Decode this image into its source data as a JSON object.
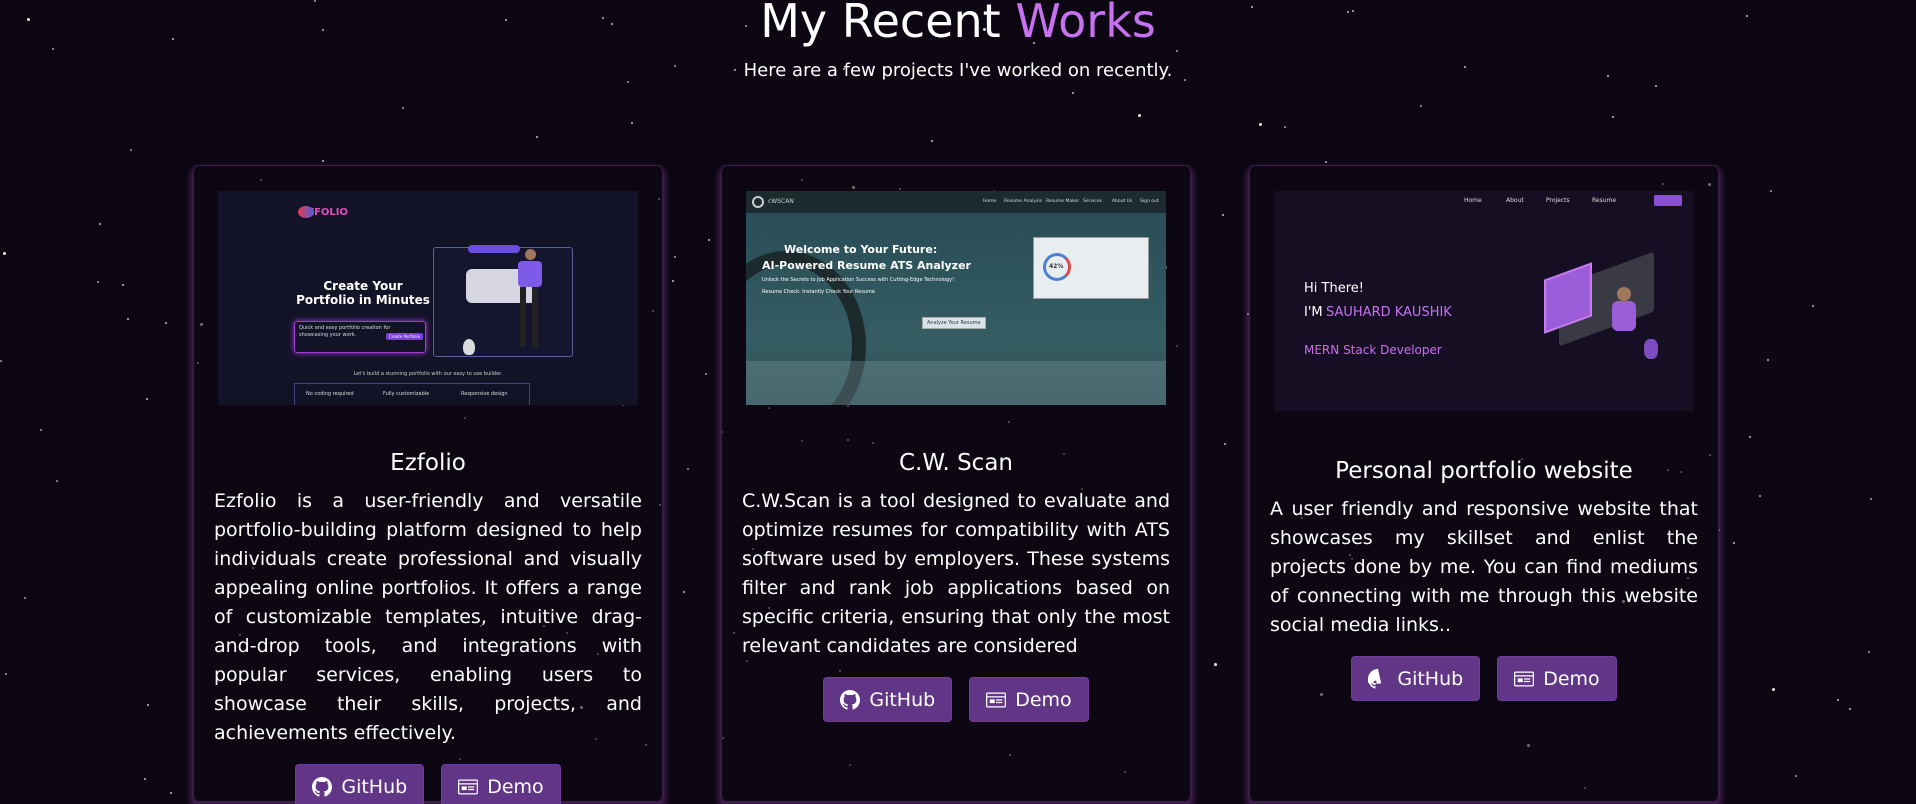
{
  "heading": {
    "prefix": "My Recent",
    "accent": "Works"
  },
  "subheading": "Here are a few projects I've worked on recently.",
  "colors": {
    "accent": "#c770f0",
    "button": "#623686",
    "background": "#0c0713"
  },
  "projects": [
    {
      "title": "Ezfolio",
      "description": "Ezfolio is a user-friendly and versatile portfolio-building platform designed to help individuals create professional and visually appealing online portfolios. It offers a range of customizable templates, intuitive drag-and-drop tools, and integrations with popular services, enabling users to showcase their skills, projects, and achievements effectively.",
      "github_label": "GitHub",
      "demo_label": "Demo",
      "thumb": {
        "brand": "EZFOLIO",
        "headline": "Create Your Portfolio in Minutes",
        "cta_text": "Quick and easy portfolio creation for showcasing your work.",
        "cta_button": "Create Portfolio",
        "tagline": "Let's build a stunning portfolio with our easy to use builder.",
        "features": [
          "No coding required",
          "Fully customizable",
          "Responsive design"
        ]
      }
    },
    {
      "title": "C.W. Scan",
      "description": "C.W.Scan is a tool designed to evaluate and optimize resumes for compatibility with ATS software used by employers. These systems filter and rank job applications based on specific criteria, ensuring that only the most relevant candidates are considered",
      "github_label": "GitHub",
      "demo_label": "Demo",
      "thumb": {
        "brand": "cWSCAN",
        "nav": [
          "Home",
          "Resume Analysis",
          "Resume Maker",
          "Services",
          "About Us",
          "Sign out"
        ],
        "line1": "Welcome to Your Future:",
        "line2": "AI-Powered Resume ATS Analyzer",
        "line3": "Unlock the Secrets to Job Application Success with Cutting-Edge Technology!",
        "line4": "Resume Check: Instantly Check Your Resume",
        "button": "Analyze Your Resume",
        "score": "42%"
      }
    },
    {
      "title": "Personal portfolio website",
      "description": "A user friendly and responsive website that showcases my skillset and enlist the projects done by me. You can find mediums of connecting with me through this website social media links..",
      "github_label": "GitHub",
      "demo_label": "Demo",
      "thumb": {
        "nav": [
          "Home",
          "About",
          "Projects",
          "Resume"
        ],
        "greeting": "Hi There!",
        "im": "I'M",
        "name": "SAUHARD KAUSHIK",
        "role": "MERN Stack Developer"
      }
    }
  ]
}
